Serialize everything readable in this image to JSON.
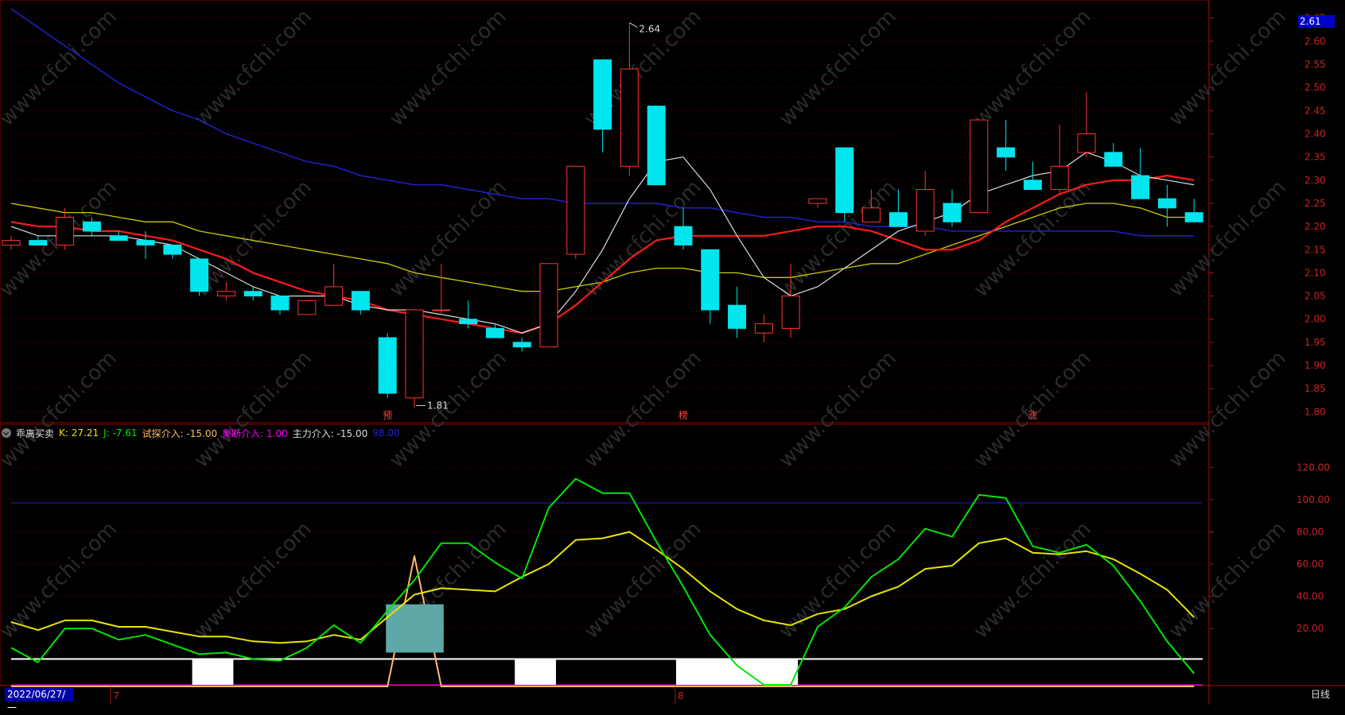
{
  "indicator": {
    "name": "乖离买卖",
    "k_label": "K: 27.21",
    "j_label": "J: -7.61",
    "trial_label": "试探介入: -15.00",
    "decisive_label": "果断介入: 1.00",
    "main_label": "主力介入: -15.00",
    "level_label": "98.00"
  },
  "current_price": "2.61",
  "date_label": "2022/06/27/一",
  "period_label": "日线",
  "month_labels": [
    "7",
    "8"
  ],
  "markers": [
    "预",
    "榜",
    "涨"
  ],
  "annotations": [
    "2.64",
    "1.81"
  ],
  "colors": {
    "up": "#ff3333",
    "down": "#00e5ee",
    "ma_white": "#dddddd",
    "ma_red": "#ff1a1a",
    "ma_yellow": "#cccc00",
    "ma_blue": "#2020cc",
    "k_line": "#e6e600",
    "j_line": "#00e600",
    "magenta": "#ff00ff",
    "blue_level": "#2020dd",
    "teal_box": "#5fa8a8",
    "spike": "#ffbb66"
  },
  "chart_data": [
    {
      "type": "candlestick",
      "y_ticks": [
        "2.65",
        "2.60",
        "2.55",
        "2.50",
        "2.45",
        "2.40",
        "2.35",
        "2.30",
        "2.25",
        "2.20",
        "2.15",
        "2.10",
        "2.05",
        "2.00",
        "1.95",
        "1.90",
        "1.85",
        "1.80"
      ],
      "ylim": [
        1.78,
        2.665
      ],
      "candles": [
        {
          "o": 2.16,
          "h": 2.18,
          "l": 2.15,
          "c": 2.17
        },
        {
          "o": 2.17,
          "h": 2.18,
          "l": 2.16,
          "c": 2.16
        },
        {
          "o": 2.16,
          "h": 2.24,
          "l": 2.15,
          "c": 2.22
        },
        {
          "o": 2.21,
          "h": 2.22,
          "l": 2.18,
          "c": 2.19
        },
        {
          "o": 2.18,
          "h": 2.19,
          "l": 2.17,
          "c": 2.17
        },
        {
          "o": 2.17,
          "h": 2.19,
          "l": 2.13,
          "c": 2.16
        },
        {
          "o": 2.16,
          "h": 2.16,
          "l": 2.13,
          "c": 2.14
        },
        {
          "o": 2.13,
          "h": 2.13,
          "l": 2.05,
          "c": 2.06
        },
        {
          "o": 2.05,
          "h": 2.08,
          "l": 2.04,
          "c": 2.06
        },
        {
          "o": 2.06,
          "h": 2.07,
          "l": 2.04,
          "c": 2.05
        },
        {
          "o": 2.05,
          "h": 2.05,
          "l": 2.01,
          "c": 2.02
        },
        {
          "o": 2.01,
          "h": 2.04,
          "l": 2.01,
          "c": 2.04
        },
        {
          "o": 2.03,
          "h": 2.12,
          "l": 2.03,
          "c": 2.07
        },
        {
          "o": 2.06,
          "h": 2.06,
          "l": 2.01,
          "c": 2.02
        },
        {
          "o": 1.96,
          "h": 1.97,
          "l": 1.83,
          "c": 1.84
        },
        {
          "o": 1.83,
          "h": 2.02,
          "l": 1.81,
          "c": 2.02
        },
        {
          "o": 2.02,
          "h": 2.12,
          "l": 2.01,
          "c": 2.02
        },
        {
          "o": 2.0,
          "h": 2.04,
          "l": 1.98,
          "c": 1.99
        },
        {
          "o": 1.98,
          "h": 1.99,
          "l": 1.96,
          "c": 1.96
        },
        {
          "o": 1.95,
          "h": 1.96,
          "l": 1.93,
          "c": 1.94
        },
        {
          "o": 1.94,
          "h": 2.12,
          "l": 1.94,
          "c": 2.12
        },
        {
          "o": 2.14,
          "h": 2.33,
          "l": 2.13,
          "c": 2.33
        },
        {
          "o": 2.56,
          "h": 2.56,
          "l": 2.36,
          "c": 2.41
        },
        {
          "o": 2.33,
          "h": 2.64,
          "l": 2.31,
          "c": 2.54
        },
        {
          "o": 2.46,
          "h": 2.46,
          "l": 2.29,
          "c": 2.29
        },
        {
          "o": 2.2,
          "h": 2.24,
          "l": 2.15,
          "c": 2.16
        },
        {
          "o": 2.15,
          "h": 2.15,
          "l": 1.99,
          "c": 2.02
        },
        {
          "o": 2.03,
          "h": 2.07,
          "l": 1.96,
          "c": 1.98
        },
        {
          "o": 1.97,
          "h": 2.01,
          "l": 1.95,
          "c": 1.99
        },
        {
          "o": 1.98,
          "h": 2.12,
          "l": 1.96,
          "c": 2.05
        },
        {
          "o": 2.25,
          "h": 2.26,
          "l": 2.24,
          "c": 2.26
        },
        {
          "o": 2.37,
          "h": 2.37,
          "l": 2.21,
          "c": 2.23
        },
        {
          "o": 2.21,
          "h": 2.28,
          "l": 2.21,
          "c": 2.24
        },
        {
          "o": 2.23,
          "h": 2.28,
          "l": 2.2,
          "c": 2.2
        },
        {
          "o": 2.19,
          "h": 2.32,
          "l": 2.18,
          "c": 2.28
        },
        {
          "o": 2.25,
          "h": 2.28,
          "l": 2.2,
          "c": 2.21
        },
        {
          "o": 2.23,
          "h": 2.43,
          "l": 2.23,
          "c": 2.43
        },
        {
          "o": 2.37,
          "h": 2.43,
          "l": 2.32,
          "c": 2.35
        },
        {
          "o": 2.3,
          "h": 2.34,
          "l": 2.28,
          "c": 2.28
        },
        {
          "o": 2.28,
          "h": 2.42,
          "l": 2.27,
          "c": 2.33
        },
        {
          "o": 2.36,
          "h": 2.49,
          "l": 2.35,
          "c": 2.4
        },
        {
          "o": 2.36,
          "h": 2.38,
          "l": 2.33,
          "c": 2.33
        },
        {
          "o": 2.31,
          "h": 2.37,
          "l": 2.26,
          "c": 2.26
        },
        {
          "o": 2.26,
          "h": 2.29,
          "l": 2.2,
          "c": 2.24
        },
        {
          "o": 2.23,
          "h": 2.26,
          "l": 2.21,
          "c": 2.21
        }
      ],
      "ma_white": [
        2.2,
        2.18,
        2.18,
        2.18,
        2.18,
        2.17,
        2.16,
        2.13,
        2.1,
        2.07,
        2.05,
        2.05,
        2.05,
        2.03,
        2.02,
        2.02,
        2.01,
        2.0,
        1.99,
        1.97,
        1.99,
        2.06,
        2.15,
        2.26,
        2.34,
        2.35,
        2.28,
        2.18,
        2.09,
        2.05,
        2.07,
        2.11,
        2.15,
        2.19,
        2.21,
        2.23,
        2.27,
        2.29,
        2.31,
        2.32,
        2.36,
        2.34,
        2.31,
        2.3,
        2.29
      ],
      "ma_red": [
        2.21,
        2.2,
        2.2,
        2.19,
        2.19,
        2.18,
        2.17,
        2.15,
        2.13,
        2.1,
        2.08,
        2.06,
        2.05,
        2.04,
        2.02,
        2.01,
        2.0,
        1.99,
        1.98,
        1.97,
        1.99,
        2.03,
        2.08,
        2.13,
        2.17,
        2.18,
        2.18,
        2.18,
        2.18,
        2.19,
        2.2,
        2.2,
        2.19,
        2.17,
        2.15,
        2.15,
        2.17,
        2.21,
        2.24,
        2.27,
        2.29,
        2.3,
        2.3,
        2.31,
        2.3
      ],
      "ma_yellow": [
        2.25,
        2.24,
        2.23,
        2.23,
        2.22,
        2.21,
        2.21,
        2.19,
        2.18,
        2.17,
        2.16,
        2.15,
        2.14,
        2.13,
        2.12,
        2.1,
        2.09,
        2.08,
        2.07,
        2.06,
        2.06,
        2.07,
        2.08,
        2.1,
        2.11,
        2.11,
        2.1,
        2.1,
        2.09,
        2.09,
        2.1,
        2.11,
        2.12,
        2.12,
        2.14,
        2.16,
        2.18,
        2.2,
        2.22,
        2.24,
        2.25,
        2.25,
        2.24,
        2.22,
        2.22
      ],
      "ma_blue": [
        2.67,
        2.63,
        2.59,
        2.55,
        2.51,
        2.48,
        2.45,
        2.43,
        2.4,
        2.38,
        2.36,
        2.34,
        2.33,
        2.31,
        2.3,
        2.29,
        2.29,
        2.28,
        2.27,
        2.26,
        2.26,
        2.25,
        2.25,
        2.25,
        2.25,
        2.24,
        2.24,
        2.23,
        2.22,
        2.22,
        2.21,
        2.21,
        2.2,
        2.2,
        2.2,
        2.19,
        2.19,
        2.19,
        2.19,
        2.19,
        2.19,
        2.19,
        2.18,
        2.18,
        2.18
      ]
    },
    {
      "type": "line",
      "y_ticks": [
        "120.00",
        "100.00",
        "80.00",
        "60.00",
        "40.00",
        "20.00"
      ],
      "ylim": [
        -16,
        136
      ],
      "reference_levels": [
        98,
        1,
        -15
      ],
      "series": [
        {
          "name": "K",
          "values": [
            24,
            19,
            25,
            25,
            21,
            21,
            18,
            15,
            15,
            12,
            11,
            12,
            16,
            13,
            27,
            41,
            45,
            44,
            43,
            52,
            60,
            75,
            76,
            80,
            69,
            57,
            43,
            32,
            25,
            22,
            29,
            32,
            40,
            46,
            57,
            59,
            73,
            76,
            67,
            66,
            68,
            63,
            54,
            44,
            27
          ]
        },
        {
          "name": "J",
          "values": [
            8,
            -1,
            20,
            20,
            13,
            16,
            10,
            4,
            5,
            1,
            0,
            8,
            22,
            11,
            31,
            50,
            73,
            73,
            61,
            51,
            95,
            113,
            104,
            104,
            74,
            46,
            16,
            -3,
            -30,
            -25,
            21,
            33,
            52,
            63,
            82,
            77,
            103,
            101,
            71,
            67,
            72,
            59,
            37,
            12,
            -8
          ]
        },
        {
          "name": "试探介入",
          "values": [
            0,
            0,
            0,
            0,
            0,
            0,
            0,
            0,
            0,
            0,
            0,
            0,
            0,
            0,
            0,
            65,
            0,
            0,
            0,
            0,
            0,
            0,
            0,
            0,
            0,
            0,
            0,
            0,
            0,
            0,
            0,
            0,
            0,
            0,
            0,
            0,
            0,
            0,
            0,
            0,
            0,
            0,
            0,
            0,
            0
          ]
        }
      ]
    }
  ]
}
